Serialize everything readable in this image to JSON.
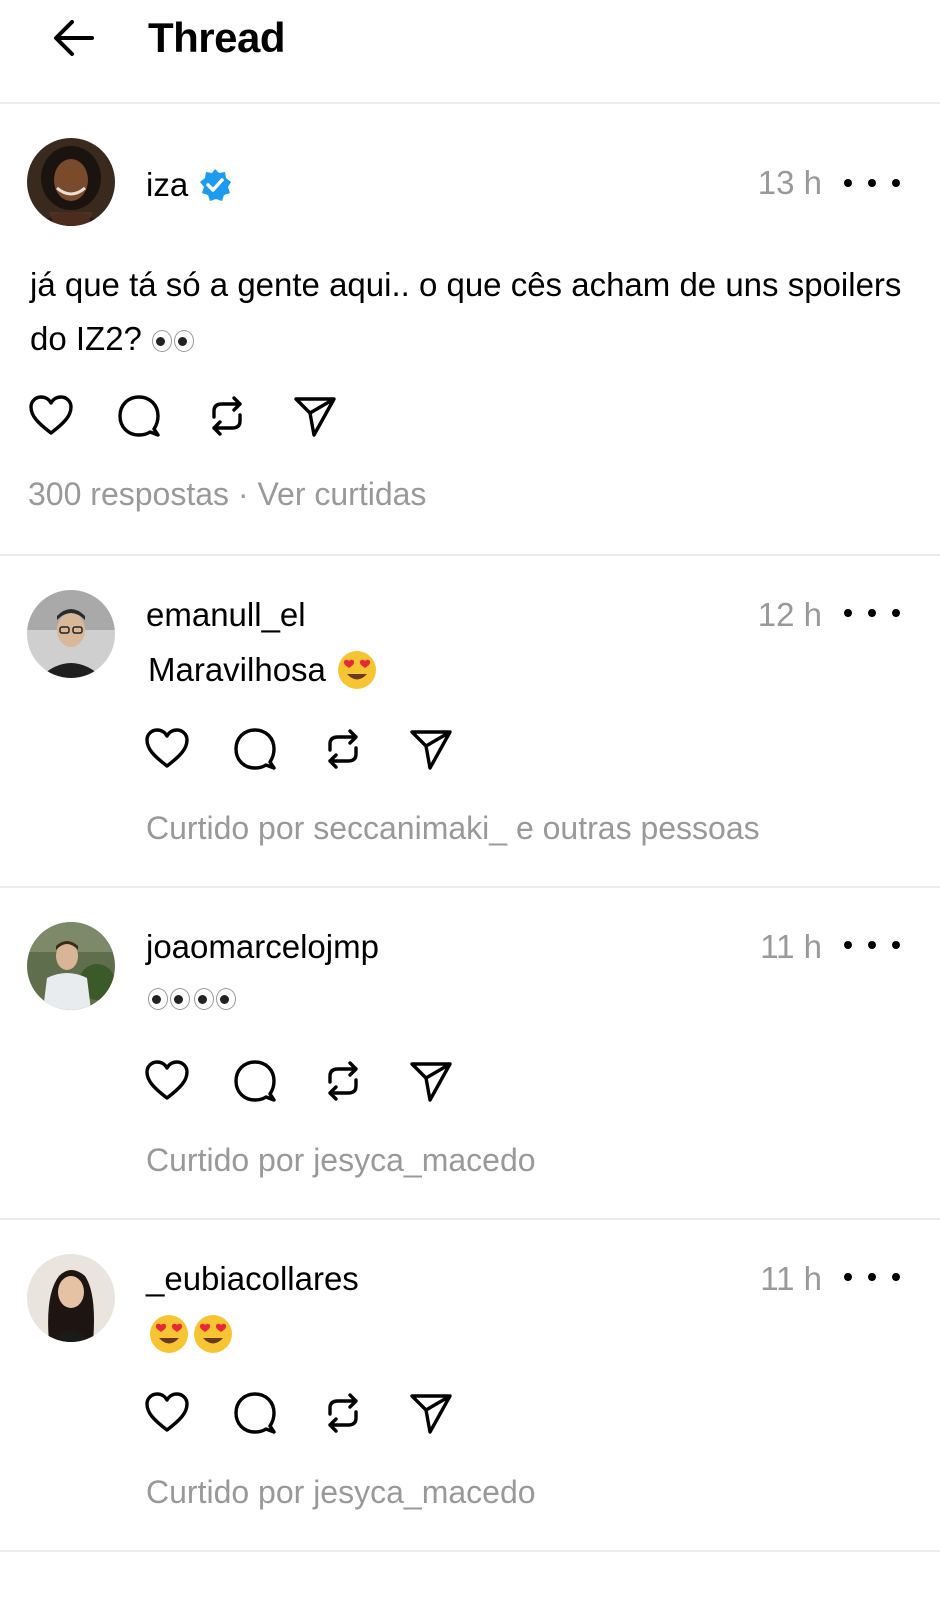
{
  "header": {
    "title": "Thread",
    "back_icon": "arrow-left-icon"
  },
  "main_post": {
    "username": "iza",
    "verified": true,
    "time": "13 h",
    "text": "já que tá só a gente aqui.. o que cês acham de uns spoilers do IZ2?",
    "text_emoji": "eyes",
    "replies_label": "300 respostas",
    "separator": "·",
    "likes_link": "Ver curtidas"
  },
  "replies": [
    {
      "username": "emanull_el",
      "time": "12 h",
      "text": "Maravilhosa",
      "emoji": "heart-eyes x1",
      "liked_by": "Curtido por seccanimaki_ e outras pessoas"
    },
    {
      "username": "joaomarcelojmp",
      "time": "11 h",
      "text": "",
      "emoji": "eyes x2",
      "liked_by": "Curtido por jesyca_macedo"
    },
    {
      "username": "_eubiacollares",
      "time": "11 h",
      "text": "",
      "emoji": "heart-eyes x2",
      "liked_by": "Curtido por jesyca_macedo"
    }
  ],
  "colors": {
    "muted": "#999999",
    "divider": "#ececec",
    "verified": "#1d9bf0",
    "emoji": "#f7c531"
  }
}
